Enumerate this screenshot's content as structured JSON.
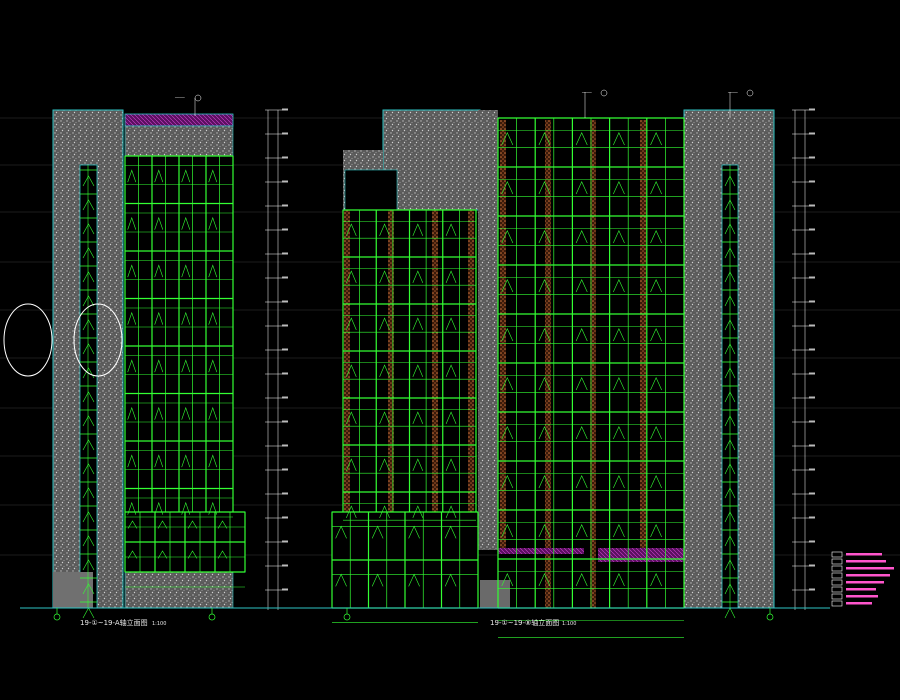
{
  "drawing": {
    "elevation_left_title": "19-①~19-A轴立面图",
    "elevation_right_title": "19-①~19-⑧轴立面图",
    "scale": "1:100"
  },
  "colors": {
    "background": "#000000",
    "glazing_lines": "#33ff33",
    "outline": "#2ec4c4",
    "stone": "#8a8a8a",
    "brick_band": "#c86a3a",
    "roof_panel": "#b020b0",
    "legend_pink": "#ff55cc",
    "annotation": "#ffffff"
  }
}
